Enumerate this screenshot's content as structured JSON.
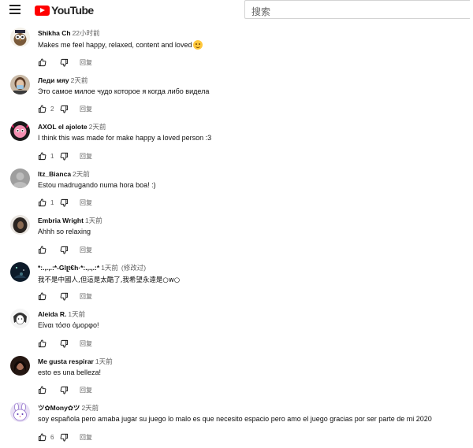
{
  "app": {
    "logo_text": "YouTube",
    "search_placeholder": "搜索"
  },
  "reply_label": "回复",
  "comments": [
    {
      "author": "Shikha Ch",
      "time": "22小时前",
      "edited": "",
      "text": "Makes me feel happy, relaxed, content and loved",
      "emoji": "smiling-face-icon",
      "likes": "",
      "avatar": "owl-cartoon"
    },
    {
      "author": "Леди мяу",
      "time": "2天前",
      "edited": "",
      "text": "Это самое милое чудо которое я когда либо видела",
      "emoji": "",
      "likes": "2",
      "avatar": "masked-person"
    },
    {
      "author": "AXOL el ajolote",
      "time": "2天前",
      "edited": "",
      "text": "I think this was made for make happy a loved person :3",
      "emoji": "",
      "likes": "1",
      "avatar": "pink-character"
    },
    {
      "author": "Itz_Bianca",
      "time": "2天前",
      "edited": "",
      "text": "Estou madrugando numa hora boa! :)",
      "emoji": "",
      "likes": "1",
      "avatar": "gray-photo"
    },
    {
      "author": "Embria Wright",
      "time": "1天前",
      "edited": "",
      "text": "Ahhh so relaxing",
      "emoji": "",
      "likes": "",
      "avatar": "dark-hair"
    },
    {
      "author": "*:.,.,.:*-Glլt€h·*:.,.,.:*",
      "time": "1天前",
      "edited": "(修改过)",
      "text": "我不是中國人,但這是太酷了,我希望永遠是○w○",
      "emoji": "",
      "likes": "",
      "avatar": "dark-night"
    },
    {
      "author": "Aleida R.",
      "time": "1天前",
      "edited": "",
      "text": "Είναι τόσο όμορφο!",
      "emoji": "",
      "likes": "",
      "avatar": "anime-sketch"
    },
    {
      "author": "Me gusta respirar",
      "time": "1天前",
      "edited": "",
      "text": "esto es una belleza!",
      "emoji": "",
      "likes": "",
      "avatar": "dark-portrait"
    },
    {
      "author": "ツ✿Mony✿ツ",
      "time": "2天前",
      "edited": "",
      "text": "soy española pero amaba jugar su juego lo malo es que necesito espacio pero amo el juego gracias por ser parte de mi 2020",
      "emoji": "",
      "likes": "6",
      "avatar": "bunny-character"
    }
  ],
  "colors": {
    "brand": "#ff0000",
    "text": "#0f0f0f",
    "secondary": "#606060"
  }
}
